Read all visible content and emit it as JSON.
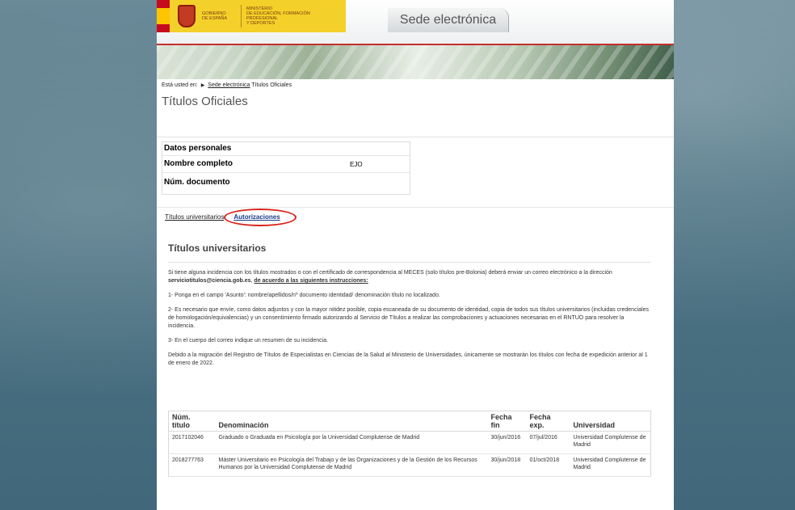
{
  "header": {
    "gov_lines": [
      "Gobierno",
      "de España"
    ],
    "ministry_lines": [
      "Ministerio",
      "de Educación, Formación Profesional",
      "y Deportes"
    ],
    "sede_label": "Sede electrónica"
  },
  "breadcrumb": {
    "prefix": "Está usted en:",
    "home_link": "Sede electrónica",
    "current": "Títulos Oficiales"
  },
  "page_title": "Títulos Oficiales",
  "personal": {
    "heading": "Datos personales",
    "name_label": "Nombre completo",
    "name_value": "EJO",
    "doc_label": "Núm. documento",
    "doc_value": ""
  },
  "tabs": [
    {
      "label": "Títulos universitarios"
    },
    {
      "label": "Autorizaciones"
    }
  ],
  "content": {
    "section_title": "Títulos universitarios",
    "intro_text": "Si tiene alguna incidencia con los títulos mostrados o con el certificado de correspondencia al MECES (solo títulos pre-Bolonia) deberá enviar un correo electrónico a la dirección ",
    "email": "serviciotitulos@ciencia.gob.es",
    "intro_sep": ", ",
    "intro_link": "de acuerdo a las siguientes instrucciones:",
    "step1": "1- Ponga en el campo 'Asunto': nombre/apellidos/nº documento identidad/ denominación título no localizado.",
    "step2": "2- Es necesario que envíe, como datos adjuntos y con la mayor nitidez posible, copia escaneada de su documento de identidad, copia de todos sus títulos universitarios (incluidas credenciales de homologación/equivalencias) y un consentimiento firmado autorizando al Servicio de Títulos a realizar las comprobaciones y actuaciones necesarias en el RNTUO para resolver la incidencia.",
    "step3": "3- En el cuerpo del correo indique un resumen de su incidencia.",
    "migration_note": "Debido a la migración del Registro de Títulos de Especialistas en Ciencias de la Salud al Ministerio de Universidades, únicamente se mostrarán los títulos con fecha de expedición anterior al 1 de enero de 2022."
  },
  "table": {
    "headers": {
      "num_1": "Núm.",
      "num_2": "título",
      "denominacion": "Denominación",
      "fin_1": "Fecha",
      "fin_2": "fin",
      "exp_1": "Fecha",
      "exp_2": "exp.",
      "universidad": "Universidad"
    },
    "rows": [
      {
        "num": "2017102046",
        "denominacion": "Graduado o Graduada en Psicología por la Universidad Complutense de Madrid",
        "fecha_fin": "30/jun/2016",
        "fecha_exp": "07/jul/2016",
        "universidad": "Universidad Complutense de Madrid"
      },
      {
        "num": "2018277763",
        "denominacion": "Máster Universitario en Psicología del Trabajo y de las Organizaciones y de la Gestión de los Recursos Humanos por la Universidad Complutense de Madrid",
        "fecha_fin": "30/jun/2018",
        "fecha_exp": "01/oct/2018",
        "universidad": "Universidad Complutense de Madrid"
      }
    ]
  },
  "colors": {
    "accent_red": "#c4302b",
    "gov_yellow": "#f4d02a",
    "annotation_red": "#d9221b",
    "active_tab_blue": "#1a3a8a"
  }
}
